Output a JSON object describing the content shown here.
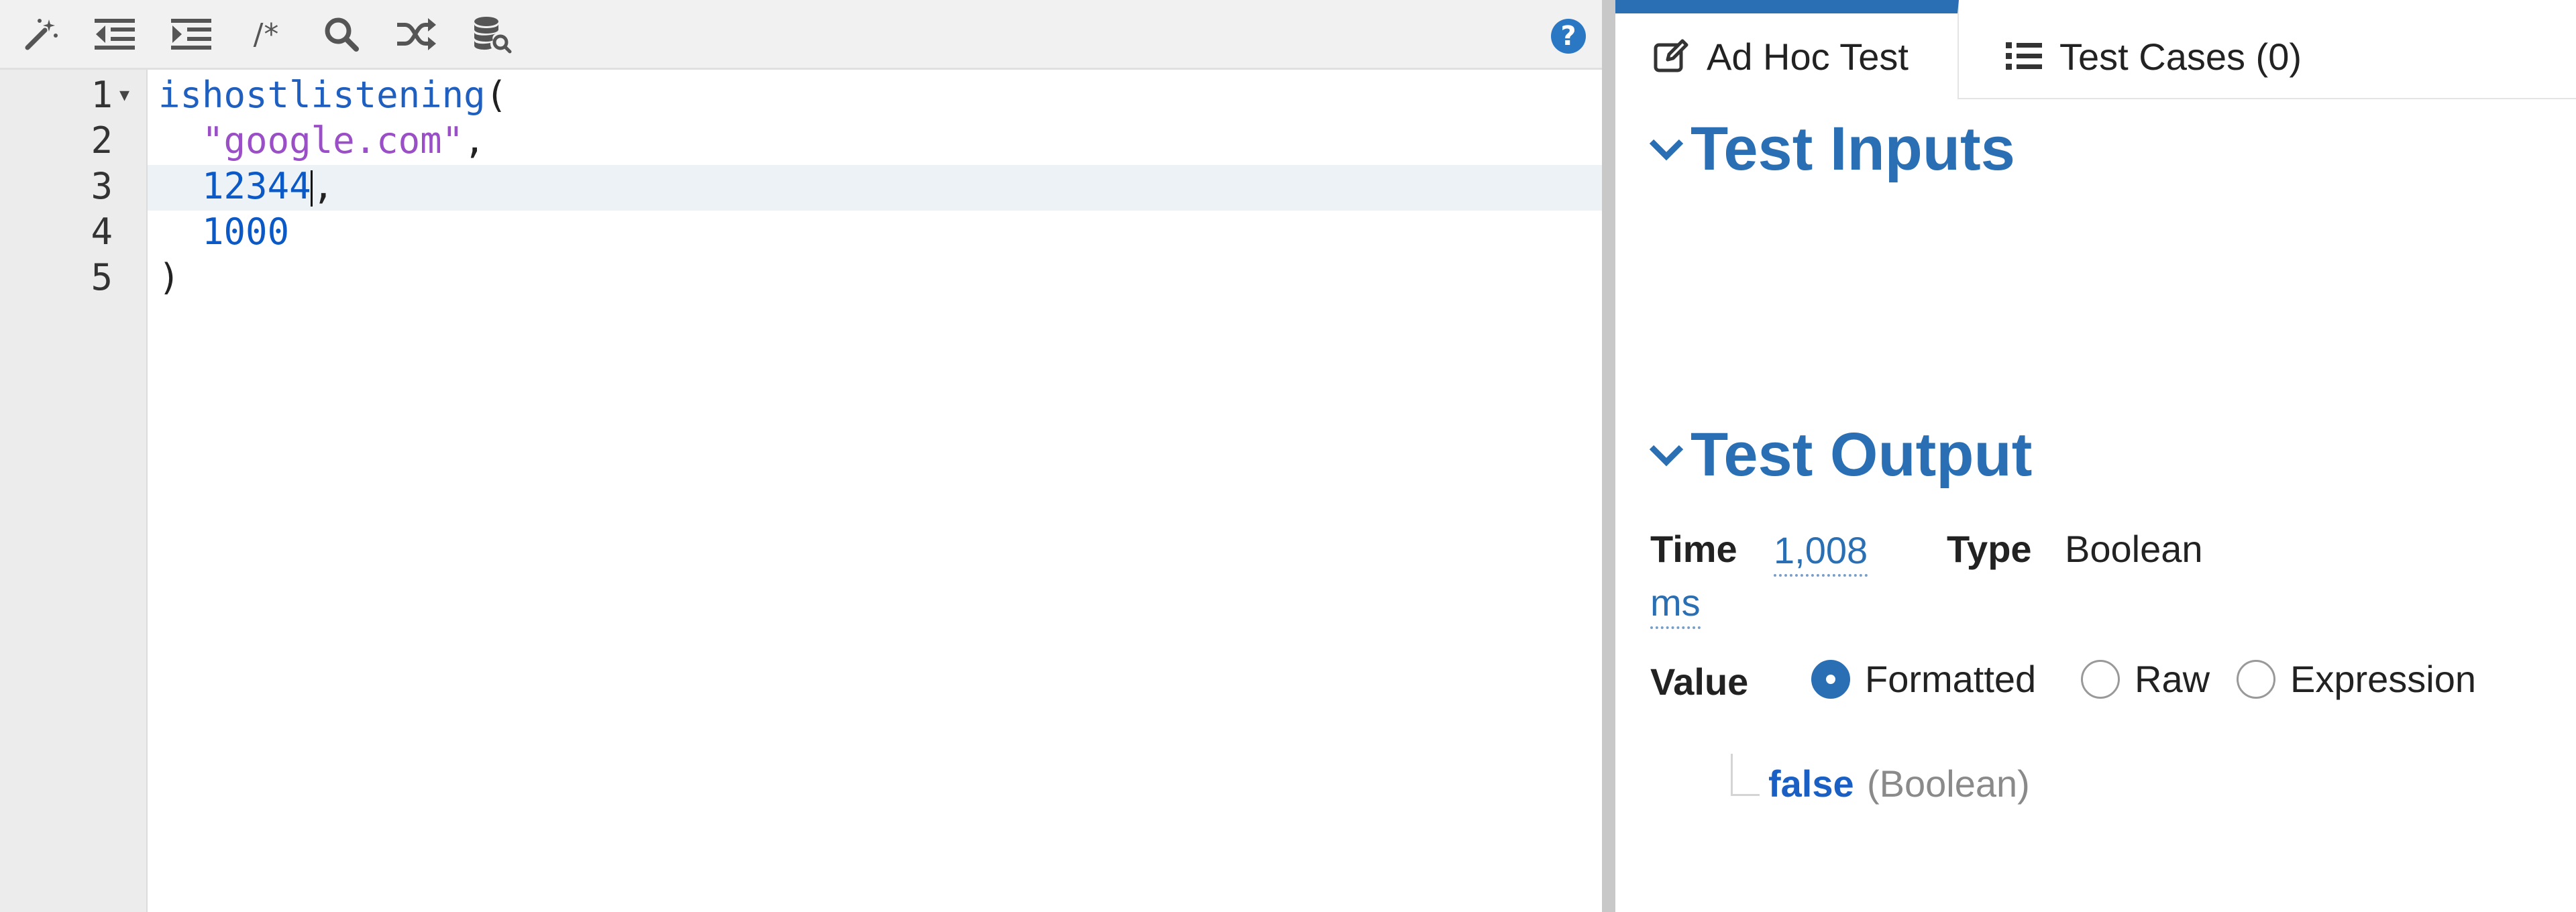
{
  "toolbar": {
    "buttons": [
      {
        "name": "magic-wand-icon"
      },
      {
        "name": "outdent-icon"
      },
      {
        "name": "indent-icon"
      },
      {
        "name": "comment-icon",
        "text": "/*"
      },
      {
        "name": "search-icon"
      },
      {
        "name": "shuffle-icon"
      },
      {
        "name": "database-search-icon"
      }
    ],
    "help_label": "?"
  },
  "editor": {
    "line_numbers": [
      "1",
      "2",
      "3",
      "4",
      "5"
    ],
    "fold_marker": "▾",
    "lines": {
      "l1_fn": "ishostlistening",
      "l1_paren": "(",
      "l2_str": "\"google.com\"",
      "l2_comma": ",",
      "l3_num": "12344",
      "l3_comma": ",",
      "l4_num": "1000",
      "l5_paren": ")"
    }
  },
  "tabs": {
    "adhoc_label": "Ad Hoc Test",
    "cases_label": "Test Cases (0)"
  },
  "sections": {
    "inputs_title": "Test Inputs",
    "output_title": "Test Output"
  },
  "output": {
    "time_label": "Time",
    "time_value": "1,008",
    "time_unit": "ms",
    "type_label": "Type",
    "type_value": "Boolean",
    "value_label": "Value",
    "formats": [
      "Formatted",
      "Raw",
      "Expression"
    ],
    "selected_format": "Formatted",
    "result_value": "false",
    "result_type": "(Boolean)"
  },
  "colors": {
    "accent": "#2a6fb3",
    "string": "#9a4fc7",
    "number": "#0b59c6"
  }
}
